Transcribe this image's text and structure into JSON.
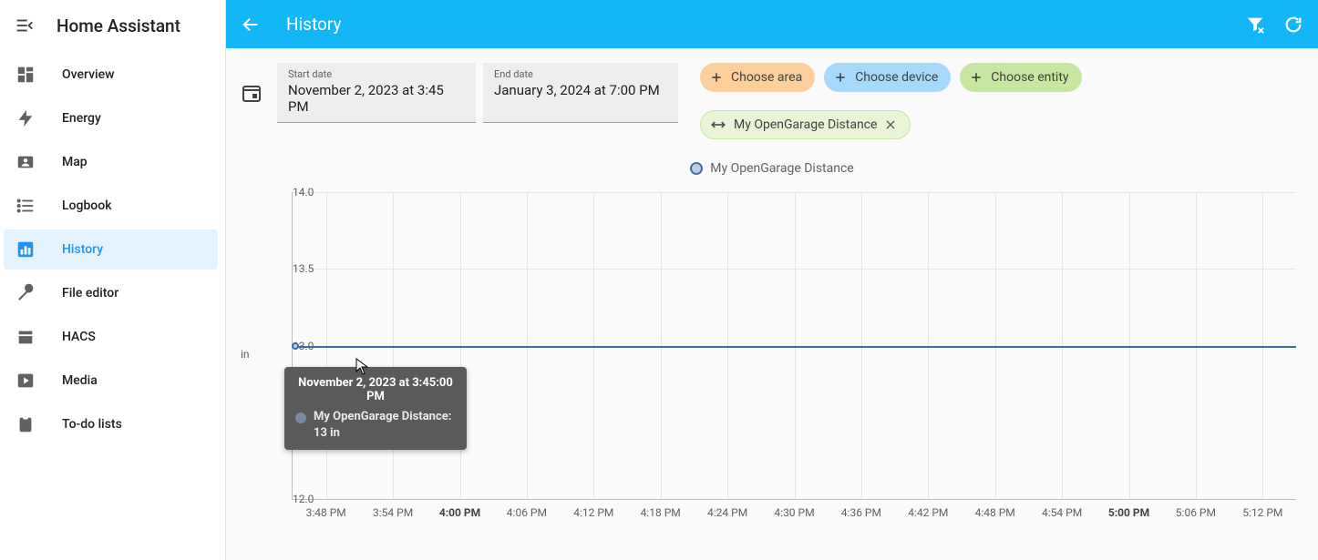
{
  "app_title": "Home Assistant",
  "sidebar": {
    "items": [
      {
        "label": "Overview",
        "active": false
      },
      {
        "label": "Energy",
        "active": false
      },
      {
        "label": "Map",
        "active": false
      },
      {
        "label": "Logbook",
        "active": false
      },
      {
        "label": "History",
        "active": true
      },
      {
        "label": "File editor",
        "active": false
      },
      {
        "label": "HACS",
        "active": false
      },
      {
        "label": "Media",
        "active": false
      },
      {
        "label": "To-do lists",
        "active": false
      }
    ]
  },
  "toolbar": {
    "title": "History"
  },
  "dates": {
    "start_label": "Start date",
    "start_value": "November 2, 2023 at 3:45 PM",
    "end_label": "End date",
    "end_value": "January 3, 2024 at 7:00 PM"
  },
  "chips": {
    "area": "Choose area",
    "device": "Choose device",
    "entity": "Choose entity",
    "selected": "My OpenGarage Distance"
  },
  "legend": {
    "label": "My OpenGarage Distance"
  },
  "tooltip": {
    "title": "November 2, 2023 at 3:45:00 PM",
    "text": "My OpenGarage Distance: 13 in"
  },
  "chart_data": {
    "type": "line",
    "series": [
      {
        "name": "My OpenGarage Distance",
        "values": [
          13,
          13,
          13,
          13,
          13,
          13,
          13,
          13,
          13,
          13,
          13,
          13,
          13,
          13,
          13
        ]
      }
    ],
    "x": [
      "3:48 PM",
      "3:54 PM",
      "4:00 PM",
      "4:06 PM",
      "4:12 PM",
      "4:18 PM",
      "4:24 PM",
      "4:30 PM",
      "4:36 PM",
      "4:42 PM",
      "4:48 PM",
      "4:54 PM",
      "5:00 PM",
      "5:06 PM",
      "5:12 PM"
    ],
    "x_bold_indices": [
      2,
      12
    ],
    "ylim": [
      12.0,
      14.0
    ],
    "yticks": [
      12.0,
      13.0,
      13.5,
      14.0
    ],
    "ylabel": "in",
    "title": "",
    "xlabel": ""
  }
}
